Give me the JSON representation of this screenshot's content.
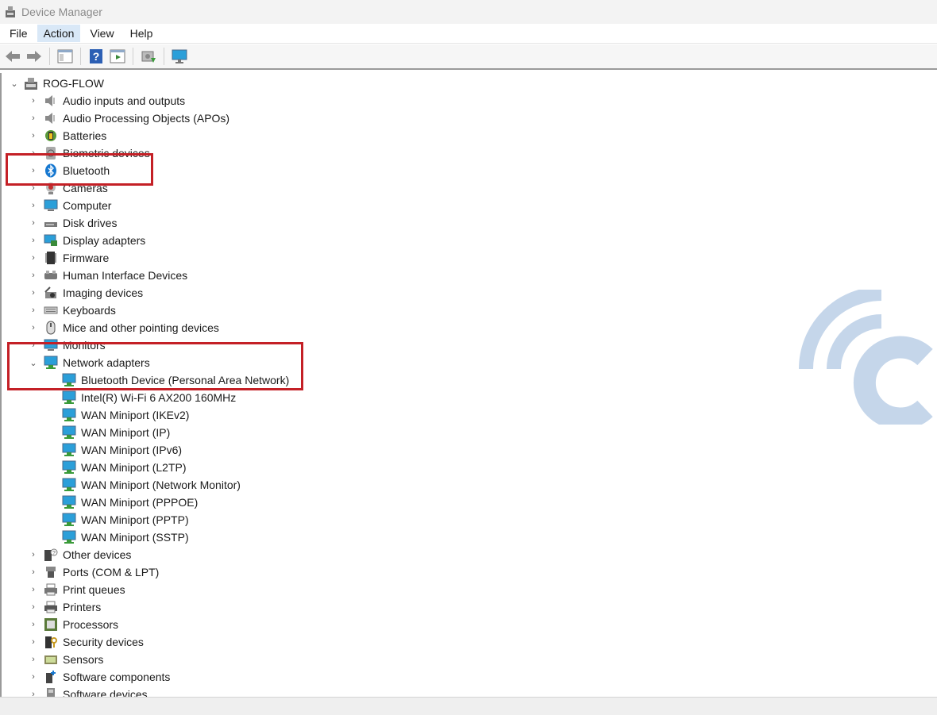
{
  "window": {
    "title": "Device Manager"
  },
  "menu": {
    "items": [
      "File",
      "Action",
      "View",
      "Help"
    ],
    "active": "Action"
  },
  "toolbar": {
    "buttons": [
      "back-arrow-icon",
      "forward-arrow-icon",
      "properties-pane-icon",
      "help-icon",
      "action-pane-icon",
      "update-driver-icon",
      "monitor-scan-icon"
    ]
  },
  "tree": {
    "root": "ROG-FLOW",
    "categories": [
      {
        "label": "Audio inputs and outputs",
        "icon": "speaker-icon"
      },
      {
        "label": "Audio Processing Objects (APOs)",
        "icon": "speaker-icon"
      },
      {
        "label": "Batteries",
        "icon": "battery-icon"
      },
      {
        "label": "Biometric devices",
        "icon": "fingerprint-icon"
      },
      {
        "label": "Bluetooth",
        "icon": "bluetooth-icon"
      },
      {
        "label": "Cameras",
        "icon": "camera-icon"
      },
      {
        "label": "Computer",
        "icon": "computer-icon"
      },
      {
        "label": "Disk drives",
        "icon": "disk-drive-icon"
      },
      {
        "label": "Display adapters",
        "icon": "display-adapter-icon"
      },
      {
        "label": "Firmware",
        "icon": "firmware-icon"
      },
      {
        "label": "Human Interface Devices",
        "icon": "hid-icon"
      },
      {
        "label": "Imaging devices",
        "icon": "imaging-icon"
      },
      {
        "label": "Keyboards",
        "icon": "keyboard-icon"
      },
      {
        "label": "Mice and other pointing devices",
        "icon": "mouse-icon"
      },
      {
        "label": "Monitors",
        "icon": "monitor-icon"
      },
      {
        "label": "Network adapters",
        "icon": "network-adapter-icon",
        "expanded": true
      }
    ],
    "network_children": [
      "Bluetooth Device (Personal Area Network)",
      "Intel(R) Wi-Fi 6 AX200 160MHz",
      "WAN Miniport (IKEv2)",
      "WAN Miniport (IP)",
      "WAN Miniport (IPv6)",
      "WAN Miniport (L2TP)",
      "WAN Miniport (Network Monitor)",
      "WAN Miniport (PPPOE)",
      "WAN Miniport (PPTP)",
      "WAN Miniport (SSTP)"
    ],
    "categories_after": [
      {
        "label": "Other devices",
        "icon": "unknown-device-icon"
      },
      {
        "label": "Ports (COM & LPT)",
        "icon": "port-icon"
      },
      {
        "label": "Print queues",
        "icon": "printer-icon"
      },
      {
        "label": "Printers",
        "icon": "printer-icon"
      },
      {
        "label": "Processors",
        "icon": "processor-icon"
      },
      {
        "label": "Security devices",
        "icon": "security-device-icon"
      },
      {
        "label": "Sensors",
        "icon": "sensor-icon"
      },
      {
        "label": "Software components",
        "icon": "software-component-icon"
      },
      {
        "label": "Software devices",
        "icon": "software-device-icon"
      }
    ]
  },
  "colors": {
    "highlight": "#c42026",
    "menu_active": "#d9e8f7",
    "watermark": "#c5d6ea"
  }
}
